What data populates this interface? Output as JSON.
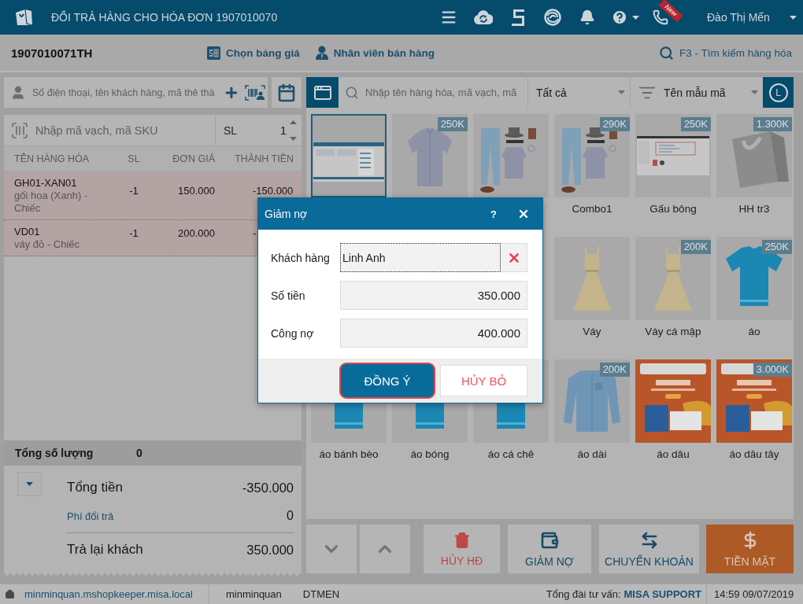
{
  "title_bar": {
    "title": "ĐỔI TRẢ HÀNG CHO HÓA ĐƠN 1907010070",
    "new_badge": "New",
    "user": "Đào Thị Mến"
  },
  "toolbar": {
    "invoice_code": "1907010071TH",
    "actions": [
      {
        "kind": "price-table",
        "label": "Chọn bảng giá"
      },
      {
        "kind": "staff",
        "label": "Nhân viên bán hàng"
      }
    ],
    "search_link": "F3 - Tìm kiếm hàng hóa"
  },
  "customer_field": {
    "placeholder": "Số điện thoại, tên khách hàng, mã thẻ thà"
  },
  "barcode_field": {
    "placeholder": "Nhập mã vạch, mã SKU"
  },
  "quantity": {
    "label": "SL",
    "value": "1"
  },
  "cart": {
    "columns": [
      "TÊN HÀNG HÓA",
      "SL",
      "ĐƠN GIÁ",
      "THÀNH TIỀN"
    ],
    "rows": [
      {
        "code": "GH01-XAN01",
        "description": "gối hoa (Xanh) - Chiếc",
        "qty": "-1",
        "price": "150.000",
        "total": "-150.000"
      },
      {
        "code": "VD01",
        "description": "váy đỏ - Chiếc",
        "qty": "-1",
        "price": "200.000",
        "total": "-"
      }
    ]
  },
  "summary": {
    "quantity_label": "Tổng số lượng",
    "quantity": "0",
    "lines": [
      {
        "kind": "total",
        "label": "Tổng tiền",
        "value": "-350.000"
      },
      {
        "kind": "fee",
        "label": "Phí đổi trả",
        "value": "0"
      },
      {
        "kind": "refund",
        "label": "Trả lại khách",
        "value": "350.000"
      }
    ]
  },
  "product_toolbar": {
    "search_placeholder": "Nhập tên hàng hóa, mã vạch, mã",
    "category": "Tất cả",
    "sort": "Tên mẫu mã",
    "layout_button": "L"
  },
  "product_rows": [
    [
      {
        "kind": "screenshot",
        "selected": true
      },
      {
        "kind": "shirt",
        "price": "250K",
        "selected": false
      },
      {
        "kind": "outfit",
        "selected": false
      },
      {
        "kind": "outfit",
        "price": "290K",
        "name": "Combo1",
        "selected": false
      },
      {
        "kind": "web-page",
        "price": "250K",
        "name": "Gấu bông",
        "selected": false
      },
      {
        "kind": "bag",
        "price": "1.300K",
        "name": "HH tr3",
        "selected": false
      }
    ],
    [
      {
        "kind": "dress",
        "name": "Váy",
        "selected": false
      },
      {
        "kind": "dress",
        "price": "200K",
        "name": "Váy cá mập",
        "selected": false
      },
      {
        "kind": "t-shirt",
        "price": "250K",
        "name": "áo",
        "selected": false
      }
    ],
    [
      {
        "kind": "t-shirt",
        "name": "áo bánh bèo",
        "selected": false
      },
      {
        "kind": "t-shirt",
        "name": "áo bóng",
        "selected": false
      },
      {
        "kind": "t-shirt",
        "name": "áo cá chê",
        "selected": false
      },
      {
        "kind": "long-shirt",
        "price": "200K",
        "name": "áo dài",
        "selected": false
      },
      {
        "kind": "banner",
        "name": "áo dâu",
        "selected": false
      },
      {
        "kind": "banner",
        "price": "3.000K",
        "name": "áo dâu tây",
        "selected": false
      }
    ]
  ],
  "action_buttons": [
    {
      "kind": "nav-down"
    },
    {
      "kind": "nav-up"
    },
    {
      "kind": "cancel",
      "label": "HỦY HĐ"
    },
    {
      "kind": "debt",
      "label": "GIẢM NỢ"
    },
    {
      "kind": "transfer",
      "label": "CHUYỂN KHOẢN"
    },
    {
      "kind": "cash",
      "label": "TIỀN MẶT"
    }
  ],
  "dialog": {
    "title": "Giảm nợ",
    "help": "?",
    "fields": [
      {
        "kind": "customer",
        "label": "Khách hàng",
        "value": "Linh Anh"
      },
      {
        "kind": "amount",
        "label": "Số tiền",
        "value": "350.000"
      },
      {
        "kind": "amount",
        "label": "Công nợ",
        "value": "400.000"
      }
    ],
    "buttons": [
      {
        "kind": "primary",
        "label": "ĐỒNG Ý",
        "highlighted": true
      },
      {
        "kind": "cancel",
        "label": "HỦY BỎ",
        "highlighted": false
      }
    ]
  },
  "status_bar": {
    "host": "minminquan.mshopkeeper.misa.local",
    "user": "minminquan",
    "staff_code": "DTMEN",
    "hotline_label": "Tổng đài tư vấn:",
    "hotline": "MISA SUPPORT",
    "datetime": "14:59 09/07/2019"
  }
}
